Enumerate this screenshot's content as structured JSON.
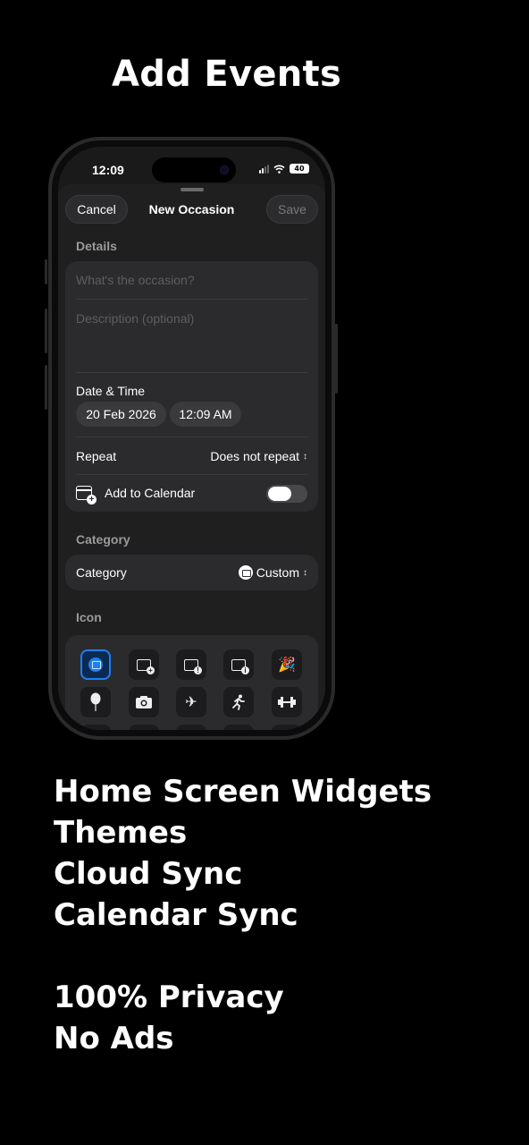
{
  "headline": "Add Events",
  "status": {
    "time": "12:09",
    "battery": "40"
  },
  "nav": {
    "cancel": "Cancel",
    "title": "New Occasion",
    "save": "Save"
  },
  "details": {
    "section": "Details",
    "occasion_placeholder": "What's the occasion?",
    "description_placeholder": "Description (optional)",
    "date_time_label": "Date & Time",
    "date": "20 Feb 2026",
    "time": "12:09 AM",
    "repeat_label": "Repeat",
    "repeat_value": "Does not repeat",
    "add_to_calendar_label": "Add to Calendar",
    "add_to_calendar_on": false
  },
  "category": {
    "section": "Category",
    "label": "Category",
    "value": "Custom"
  },
  "icon_section": {
    "section": "Icon"
  },
  "icons": [
    "calendar-icon",
    "calendar-add-icon",
    "calendar-alert-icon",
    "calendar-info-icon",
    "party-popper-icon",
    "balloon-icon",
    "camera-icon",
    "airplane-icon",
    "runner-icon",
    "dumbbell-icon"
  ],
  "features": [
    "Home Screen Widgets",
    "Themes",
    "Cloud Sync",
    "Calendar Sync",
    "100% Privacy",
    "No Ads"
  ],
  "colors": {
    "accent": "#1e7ff0",
    "background": "#000000",
    "card": "#2b2b2d"
  }
}
